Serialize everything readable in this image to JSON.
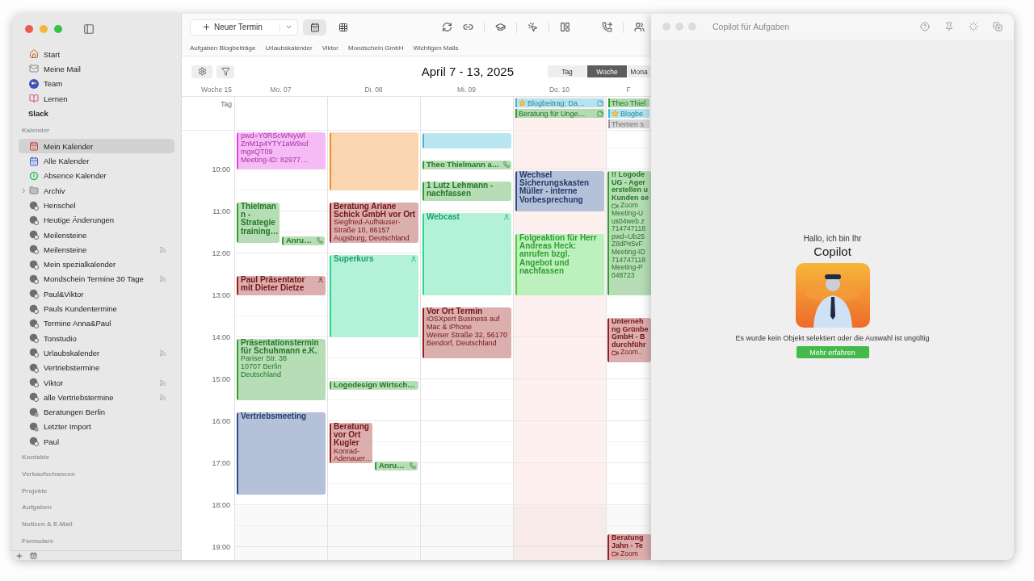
{
  "main_window": {
    "sidebar": {
      "top_items": [
        {
          "label": "Start",
          "kind": "home",
          "selected": false
        },
        {
          "label": "Meine Mail",
          "kind": "mail",
          "selected": false
        },
        {
          "label": "Team",
          "kind": "team",
          "selected": false
        },
        {
          "label": "Lernen",
          "kind": "learn",
          "selected": false
        },
        {
          "label": "Slack",
          "kind": "plain",
          "selected": false
        }
      ],
      "sections": [
        {
          "title": "Kalender",
          "items": [
            {
              "label": "Mein Kalender",
              "kind": "calendar-red",
              "selected": true,
              "shared": false
            },
            {
              "label": "Alle Kalender",
              "kind": "calendar-blue",
              "selected": false,
              "shared": false
            },
            {
              "label": "Absence Kalender",
              "kind": "absence",
              "selected": false,
              "shared": false
            },
            {
              "label": "Archiv",
              "kind": "folder",
              "selected": false,
              "shared": false,
              "expanded": false
            },
            {
              "label": "Henschel",
              "kind": "user-calendar",
              "selected": false,
              "shared": false
            },
            {
              "label": "Heutige Änderungen",
              "kind": "user-calendar",
              "selected": false,
              "shared": false
            },
            {
              "label": "Meilensteine",
              "kind": "user-calendar",
              "selected": false,
              "shared": false
            },
            {
              "label": "Meilensteine",
              "kind": "user-calendar",
              "selected": false,
              "shared": true
            },
            {
              "label": "Mein spezialkalender",
              "kind": "user-calendar",
              "selected": false,
              "shared": false
            },
            {
              "label": "Mondschein Termine 30 Tage",
              "kind": "user-calendar",
              "selected": false,
              "shared": true
            },
            {
              "label": "Paul&Viktor",
              "kind": "user-calendar",
              "selected": false,
              "shared": false
            },
            {
              "label": "Pauls Kundentermine",
              "kind": "user-calendar",
              "selected": false,
              "shared": false
            },
            {
              "label": "Termine Anna&Paul",
              "kind": "user-calendar",
              "selected": false,
              "shared": false
            },
            {
              "label": "Tonstudio",
              "kind": "user-calendar",
              "selected": false,
              "shared": false
            },
            {
              "label": "Urlaubskalender",
              "kind": "user-calendar",
              "selected": false,
              "shared": true
            },
            {
              "label": "Vertriebstermine",
              "kind": "user-calendar",
              "selected": false,
              "shared": false
            },
            {
              "label": "Viktor",
              "kind": "user-calendar",
              "selected": false,
              "shared": true
            },
            {
              "label": "alle Vertriebstermine",
              "kind": "user-calendar",
              "selected": false,
              "shared": true
            },
            {
              "label": "Beratungen Berlin",
              "kind": "import",
              "selected": false,
              "shared": false
            },
            {
              "label": "Letzter Import",
              "kind": "import",
              "selected": false,
              "shared": false
            },
            {
              "label": "Paul",
              "kind": "user-calendar",
              "selected": false,
              "shared": false
            }
          ]
        },
        {
          "title": "Kontakte"
        },
        {
          "title": "Verkaufschancen"
        },
        {
          "title": "Projekte"
        },
        {
          "title": "Aufgaben"
        },
        {
          "title": "Notizen & E-Mail"
        },
        {
          "title": "Formulare"
        }
      ]
    },
    "toolbar": {
      "new_button": "Neuer Termin",
      "views": [
        {
          "kind": "calendar",
          "selected": true
        },
        {
          "kind": "grid",
          "selected": false
        }
      ]
    },
    "favorites": [
      "Aufgaben Blogbeiträge",
      "Urlaubskalender",
      "Viktor",
      "Mondschein GmbH",
      "Wichtigen Mails"
    ],
    "calendar": {
      "title": "April 7 - 13, 2025",
      "modes": [
        {
          "label": "Tag",
          "selected": false
        },
        {
          "label": "Woche",
          "selected": true
        },
        {
          "label": "Mona",
          "selected": false
        }
      ],
      "week_label": "Woche 15",
      "allday_label": "Tag",
      "hours": [
        "10:00",
        "11:00",
        "12:00",
        "13:00",
        "14:00",
        "15:00",
        "16:00",
        "17:00",
        "18:00",
        "19:00"
      ],
      "days": [
        {
          "label": "Mo. 07",
          "today": false,
          "events": [
            {
              "details": "pwd=Y0RScWNyWl\nZnM1p4YTY1aW9xd\nmgxQT09\nMeeting-ID: 82977…",
              "color": "#e23ee0",
              "kind": "plain"
            },
            {
              "title": "Thielman\nn -\nStrategie\ntraining…",
              "color": "#2f9e2f",
              "kind": "plain"
            },
            {
              "title": "Anru…",
              "color": "#2f9e2f",
              "kind": "phone"
            },
            {
              "title": "Paul Präsentator mit Dieter Dietze",
              "color": "#9b1b1b",
              "kind": "person"
            },
            {
              "title": "Präsentationstermin für Schuhmann e.K.",
              "details": "Pariser Str. 38\n10707 Berlin\nDeutschland",
              "color": "#2f9e2f",
              "kind": "plain"
            },
            {
              "title": "Vertriebsmeeting",
              "color": "#2c4f8f",
              "kind": "plain"
            }
          ]
        },
        {
          "label": "Di. 08",
          "today": false,
          "events": [
            {
              "color": "#f28a1e",
              "kind": "plain"
            },
            {
              "title": "Beratung Ariane Schick GmbH vor Ort",
              "details": "Siegfried-Aufhäuser-Straße 10, 86157 Augsburg, Deutschland",
              "color": "#9b1b1b",
              "kind": "plain"
            },
            {
              "title": "Superkurs",
              "color": "#25d68f",
              "kind": "person"
            },
            {
              "title": "Logodesign Wirtsch…",
              "color": "#2f9e2f",
              "kind": "plain"
            },
            {
              "title": "Beratung vor Ort Kugler",
              "details": "Konrad-\nAdenauer…",
              "color": "#9b1b1b",
              "kind": "plain"
            },
            {
              "title": "Anru…",
              "color": "#2f9e2f",
              "kind": "phone"
            }
          ]
        },
        {
          "label": "Mi. 09",
          "today": false,
          "events": [
            {
              "color": "#3bb7d9",
              "kind": "plain"
            },
            {
              "title": "Theo Thielmann a…",
              "color": "#2f9e2f",
              "kind": "phone"
            },
            {
              "title": "1 Lutz Lehmann - nachfassen",
              "color": "#2f9e2f",
              "kind": "plain"
            },
            {
              "title": "Webcast",
              "color": "#25d68f",
              "kind": "person"
            },
            {
              "title": "Vor Ort Termin",
              "details": "iOSXpert Business auf Mac & iPhone\nWeiser Straße 32, 56170 Bendorf, Deutschland",
              "color": "#9b1b1b",
              "kind": "plain"
            }
          ]
        },
        {
          "label": "Do. 10",
          "today": true,
          "all_day": [
            {
              "title": "Blogbeitrag: Da…",
              "color": "#3bb7d9",
              "star": true,
              "note": true
            },
            {
              "title": "Beratung für Unge…",
              "color": "#2f9e2f",
              "star": false,
              "note": true
            }
          ],
          "events": [
            {
              "title": "Wechsel Sicherungskasten Müller - interne Vorbesprechung",
              "color": "#2c4f8f",
              "kind": "plain"
            },
            {
              "title": "Folgeaktion für Herr Andreas Heck: anrufen bzgl. Angebot und nachfassen",
              "color": "#3fd43f",
              "kind": "plain"
            }
          ]
        },
        {
          "label": "F",
          "today": false,
          "all_day": [
            {
              "title": "Theo Thiel",
              "color": "#2f9e2f",
              "star": false,
              "note": false
            },
            {
              "title": "Blogbe",
              "color": "#3bb7d9",
              "star": true,
              "note": false
            },
            {
              "title": "Themen s",
              "color": "#9a9a9a",
              "star": false,
              "note": false
            }
          ],
          "events": [
            {
              "title": "!! Logode\nUG - Ager\nerstellen u\nKunden se",
              "video_label": "Zoom",
              "details": "Meeting-U\nus04web.z\n714747118\npwd=Ub25\nZ8dPx5vF\nMeeting-ID\n714747118\nMeeting-P\n048723",
              "color": "#2f9e2f",
              "kind": "plain"
            },
            {
              "title": "Unterneh\nng Grünbe\nGmbH - B\ndurchführ",
              "video_label": "Zoom..",
              "color": "#9b1b1b",
              "kind": "plain"
            },
            {
              "title": "Beratung\nJahn - Te",
              "video_label": "Zoom",
              "color": "#9b1b1b",
              "kind": "plain"
            }
          ]
        }
      ]
    }
  },
  "copilot": {
    "title": "Copilot für Aufgaben",
    "greeting": "Hallo, ich bin Ihr",
    "name": "Copilot",
    "message": "Es wurde kein Objekt selektiert oder die Auswahl ist ungültig",
    "button": "Mehr erfahren"
  }
}
